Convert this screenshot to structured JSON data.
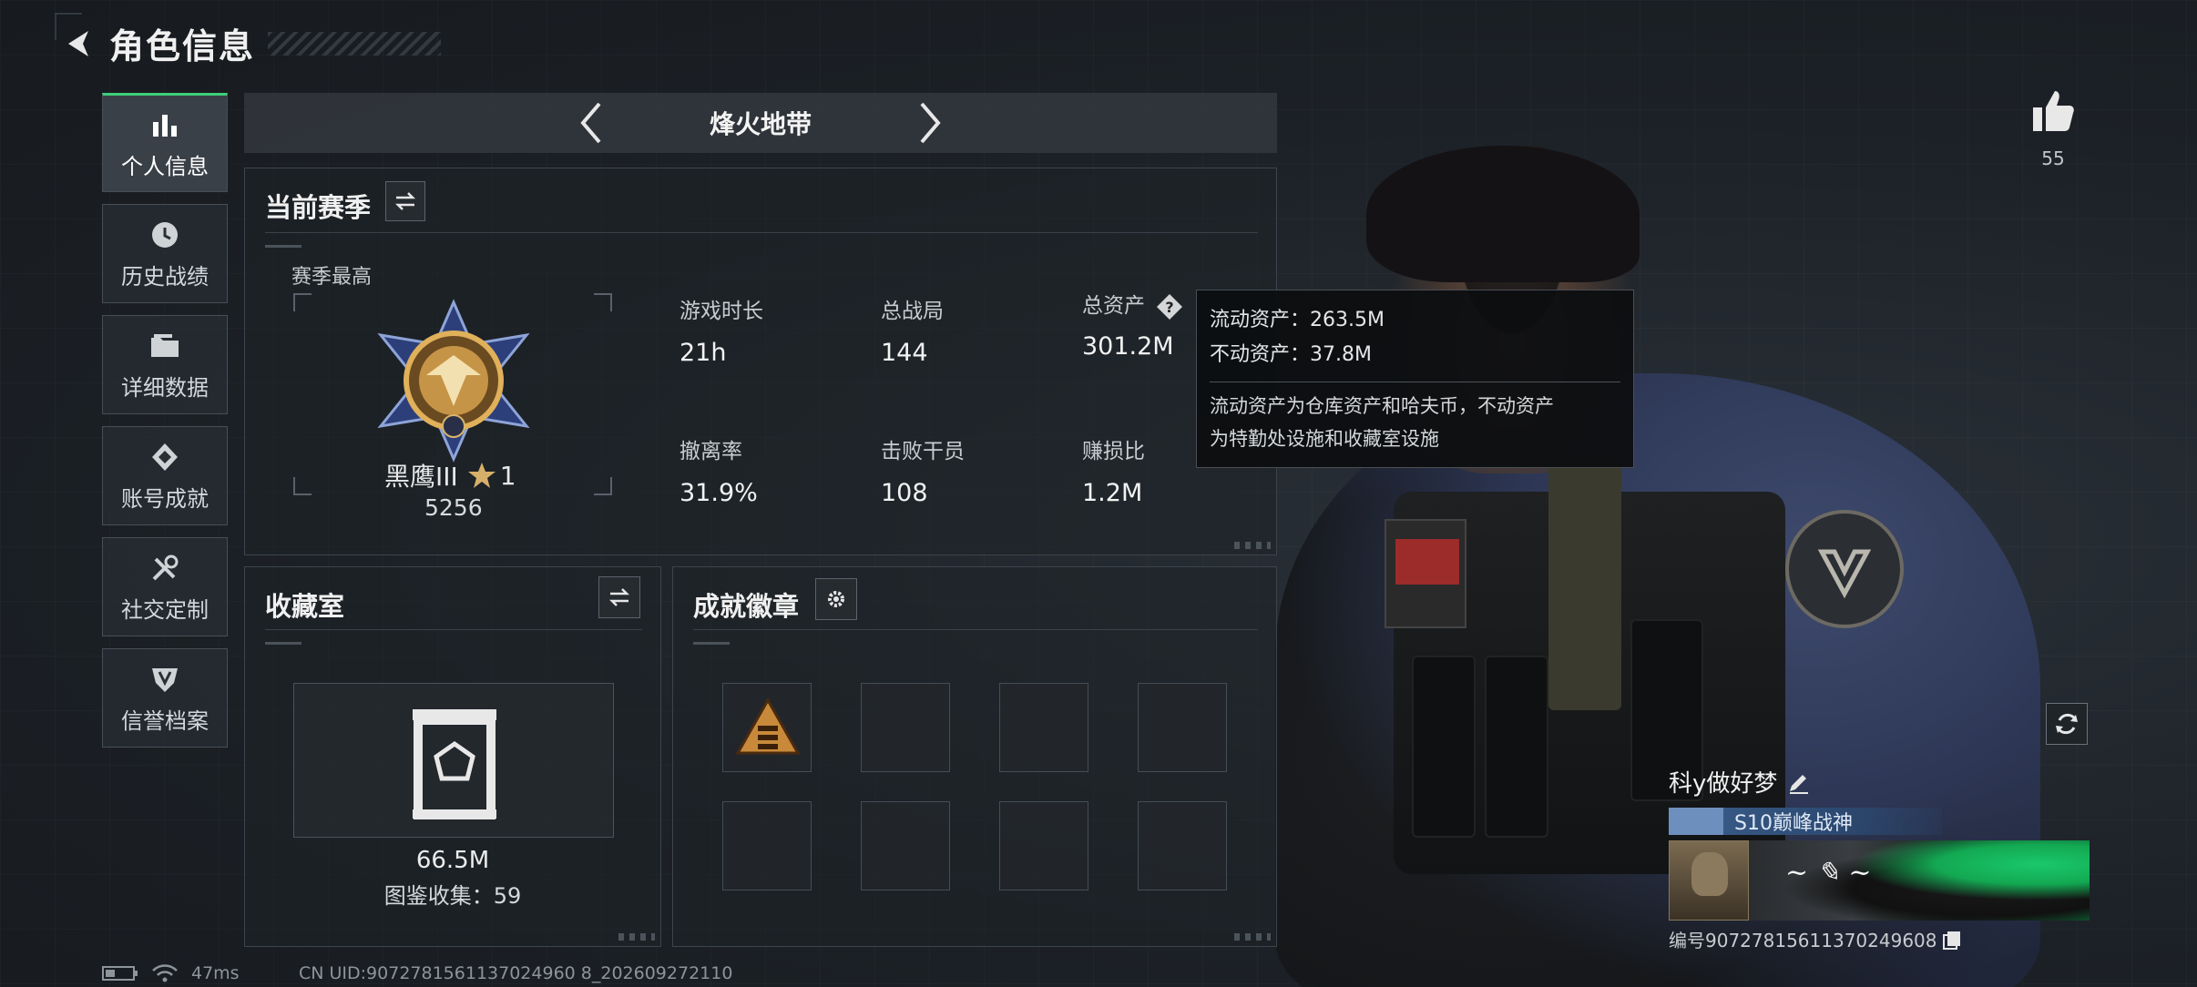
{
  "header": {
    "title": "角色信息"
  },
  "sidebar": {
    "items": [
      {
        "label": "个人信息",
        "icon": "bar-chart-icon",
        "active": true
      },
      {
        "label": "历史战绩",
        "icon": "history-clock-icon",
        "active": false
      },
      {
        "label": "详细数据",
        "icon": "folder-icon",
        "active": false
      },
      {
        "label": "账号成就",
        "icon": "achievement-icon",
        "active": false
      },
      {
        "label": "社交定制",
        "icon": "tools-icon",
        "active": false
      },
      {
        "label": "信誉档案",
        "icon": "reputation-icon",
        "active": false
      }
    ]
  },
  "mode": {
    "name": "烽火地带"
  },
  "season": {
    "title": "当前赛季",
    "best_label": "赛季最高",
    "rank_name": "黑鹰III",
    "rank_stars": "1",
    "rank_points": "5256",
    "stats": [
      {
        "label": "游戏时长",
        "value": "21h"
      },
      {
        "label": "总战局",
        "value": "144"
      },
      {
        "label": "总资产",
        "value": "301.2M"
      },
      {
        "label": "撤离率",
        "value": "31.9%"
      },
      {
        "label": "击败干员",
        "value": "108"
      },
      {
        "label": "赚损比",
        "value": "1.2M"
      }
    ]
  },
  "tooltip": {
    "liquid": "流动资产：263.5M",
    "fixed": "不动资产：37.8M",
    "desc_line1": "流动资产为仓库资产和哈夫币，不动资产",
    "desc_line2": "为特勤处设施和收藏室设施"
  },
  "collection": {
    "title": "收藏室",
    "value": "66.5M",
    "count_text": "图鉴收集：59"
  },
  "badges": {
    "title": "成就徽章"
  },
  "likes": {
    "count": "55"
  },
  "player": {
    "name": "科y做好梦",
    "title": "S10巅峰战神",
    "id_text": "编号9072781561137024960​8"
  },
  "status": {
    "ping": "47ms",
    "uid": "CN UID:9072781561137024960 8_202609272110"
  },
  "colors": {
    "accent_green": "#3ccf7a",
    "tooltip_bg": "#0c0e10",
    "title_blue": "#3c5f8c"
  }
}
